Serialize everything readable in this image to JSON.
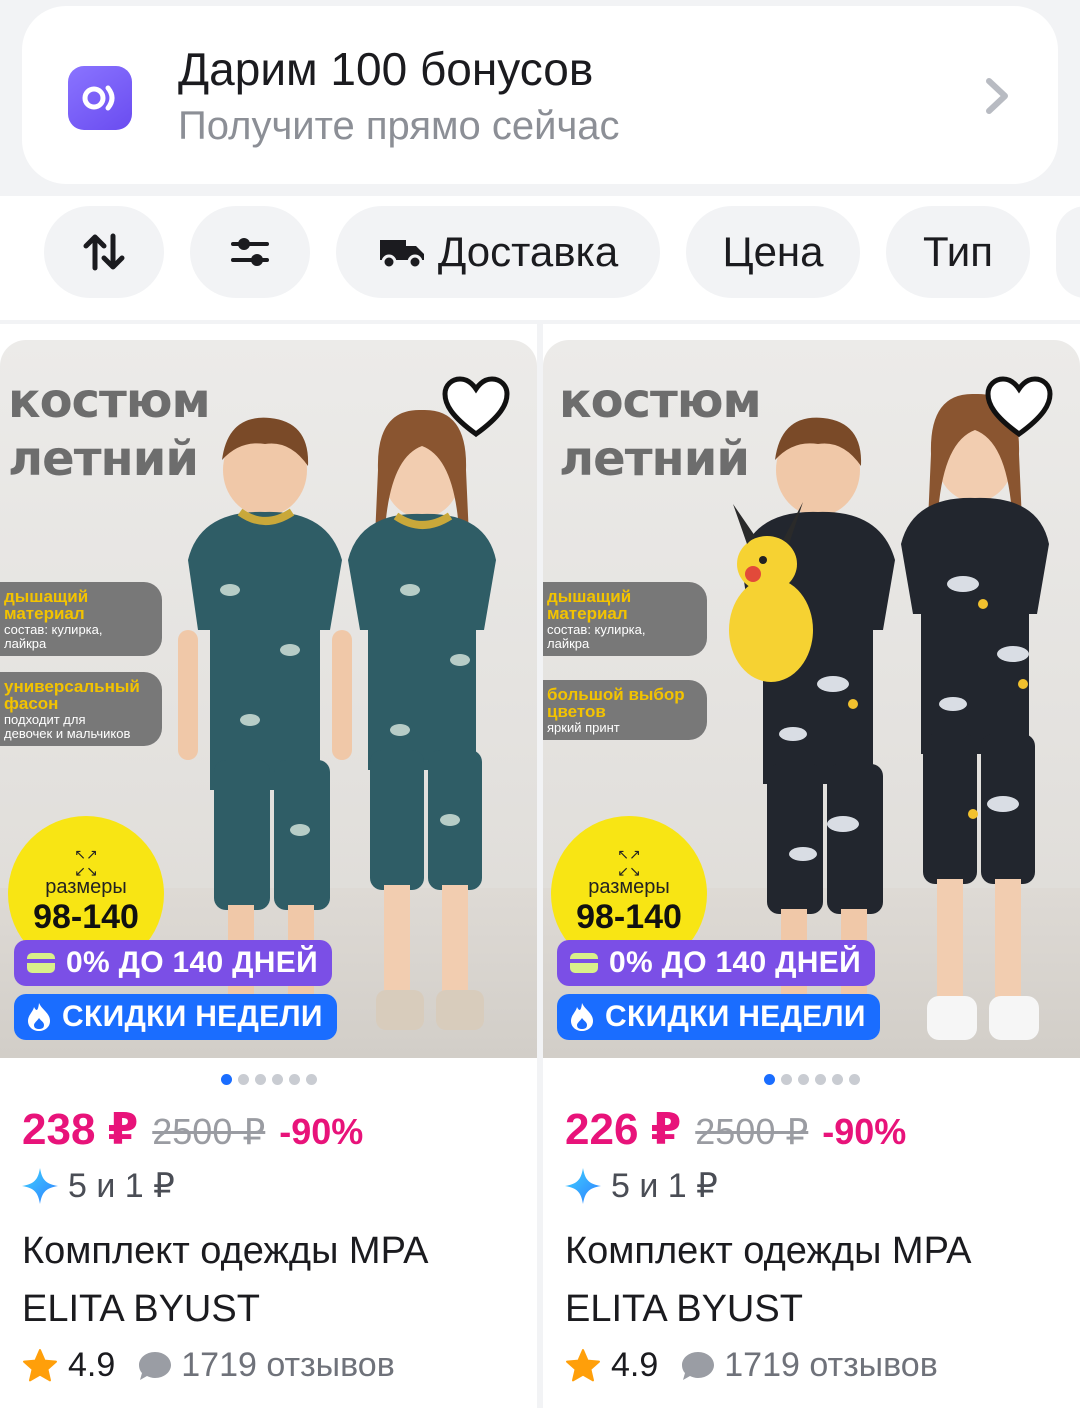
{
  "promo": {
    "title": "Дарим 100 бонусов",
    "subtitle": "Получите прямо сейчас",
    "icon": "app-logo-icon",
    "chevron": "chevron-right-icon"
  },
  "filters": {
    "sort_icon": "sort-arrows-icon",
    "filter_icon": "sliders-icon",
    "delivery_label": "Доставка",
    "price_label": "Цена",
    "type_label": "Тип"
  },
  "colors": {
    "price": "#e8137a",
    "installment_badge": "#7b4fe6",
    "sale_badge": "#1a6dff",
    "active_dot": "#1a6dff"
  },
  "products": [
    {
      "image": {
        "headline_1": "костюм",
        "headline_2": "летний",
        "tag1_title_1": "дышащий",
        "tag1_title_2": "материал",
        "tag1_desc_1": "состав: кулирка,",
        "tag1_desc_2": "лайкра",
        "tag2_title_1": "универсальный",
        "tag2_title_2": "фасон",
        "tag2_desc_1": "подходит для",
        "tag2_desc_2": "девочек и мальчиков",
        "sizes_label": "размеры",
        "sizes_value": "98-140"
      },
      "badge_installment": "0% ДО 140 ДНЕЙ",
      "badge_sale": "СКИДКИ НЕДЕЛИ",
      "gallery_total": 6,
      "gallery_index": 1,
      "price": "238 ₽",
      "old_price": "2500 ₽",
      "discount": "-90%",
      "bonus": "5 и 1 ₽",
      "title": "Комплект одежды MPA ELITA BYUST",
      "rating": "4.9",
      "reviews": "1719 отзывов"
    },
    {
      "image": {
        "headline_1": "костюм",
        "headline_2": "летний",
        "tag1_title_1": "дышащий",
        "tag1_title_2": "материал",
        "tag1_desc_1": "состав: кулирка,",
        "tag1_desc_2": "лайкра",
        "tag2_title_1": "большой выбор",
        "tag2_title_2": "цветов",
        "tag2_desc_1": "яркий принт",
        "tag2_desc_2": "",
        "sizes_label": "размеры",
        "sizes_value": "98-140"
      },
      "badge_installment": "0% ДО 140 ДНЕЙ",
      "badge_sale": "СКИДКИ НЕДЕЛИ",
      "gallery_total": 6,
      "gallery_index": 1,
      "price": "226 ₽",
      "old_price": "2500 ₽",
      "discount": "-90%",
      "bonus": "5 и 1 ₽",
      "title": "Комплект одежды MPA ELITA BYUST",
      "rating": "4.9",
      "reviews": "1719 отзывов"
    }
  ]
}
